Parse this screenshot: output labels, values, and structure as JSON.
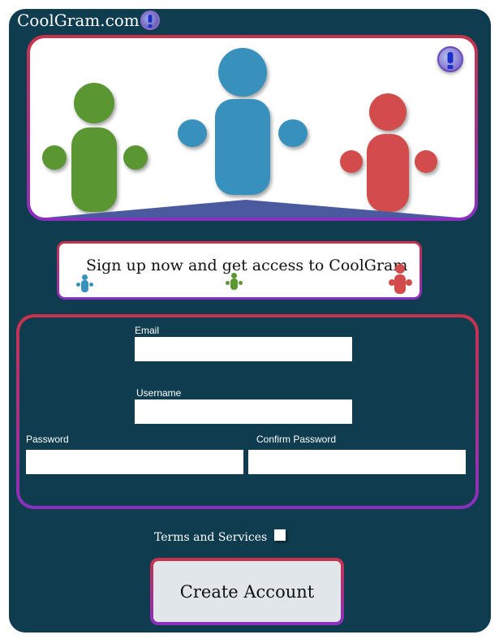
{
  "header": {
    "brand": "CoolGram.com",
    "alert_icon": "exclamation-alert-icon"
  },
  "hero": {
    "illustration": "group-of-people",
    "alert_icon": "exclamation-alert-icon",
    "colors": {
      "green": "#5a9632",
      "blue": "#3891bc",
      "red": "#d24c4c",
      "stage": "#4b5a9e"
    }
  },
  "banner": {
    "text": "Sign up now and get access to CoolGram"
  },
  "form": {
    "email": {
      "label": "Email",
      "value": "",
      "placeholder": ""
    },
    "username": {
      "label": "Username",
      "value": "",
      "placeholder": ""
    },
    "password": {
      "label": "Password",
      "value": "",
      "placeholder": ""
    },
    "confirm_password": {
      "label": "Confirm Password",
      "value": "",
      "placeholder": ""
    }
  },
  "terms": {
    "label": "Terms and Services",
    "checked": false
  },
  "submit": {
    "label": "Create Account"
  },
  "theme": {
    "background": "#0f3d4f",
    "frame_gradient": [
      "#c8334a",
      "#8a2fc0"
    ]
  }
}
